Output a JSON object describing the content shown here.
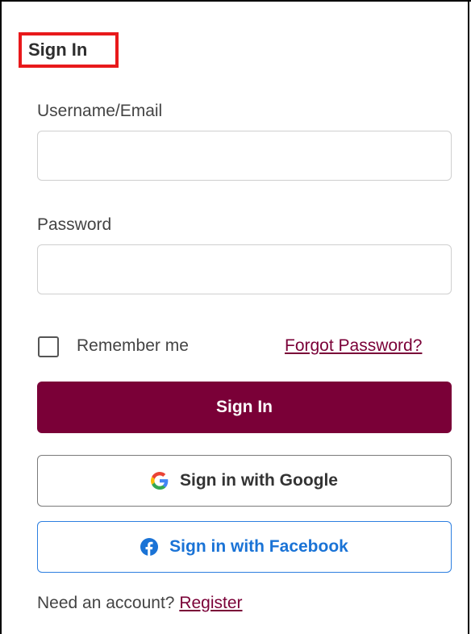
{
  "form": {
    "title": "Sign In",
    "username_label": "Username/Email",
    "username_value": "",
    "password_label": "Password",
    "password_value": "",
    "remember_label": "Remember me",
    "remember_checked": false,
    "forgot_link": "Forgot Password?",
    "sign_in_button": "Sign In",
    "google_button": "Sign in with Google",
    "facebook_button": "Sign in with Facebook",
    "need_account_text": "Need an account?",
    "register_link": "Register"
  },
  "colors": {
    "primary": "#7a0037",
    "highlight": "#e8191b",
    "facebook": "#1a73d6"
  },
  "icons": {
    "google": "google-icon",
    "facebook": "facebook-icon"
  }
}
